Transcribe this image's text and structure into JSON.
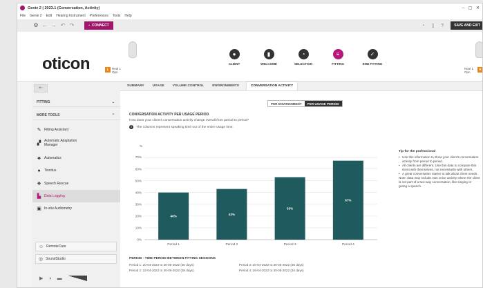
{
  "window": {
    "title": "Genie 2 | 2023.1 (Conversation, Activity)",
    "controls": "– ▢ ✕"
  },
  "menu": [
    "File",
    "Genie 2",
    "Edit",
    "Hearing Instrument",
    "Preferences",
    "Tools",
    "Help"
  ],
  "toolbar": {
    "connect_label": "CONNECT",
    "save_exit_label": "SAVE AND EXIT"
  },
  "header": {
    "logo": "oticon",
    "left_device": {
      "badge": "L",
      "line1": "Real 1",
      "line2": "Opn"
    },
    "right_device": {
      "badge": "R",
      "line1": "Real 1",
      "line2": "Opn"
    },
    "steps": [
      {
        "label": "CLIENT",
        "icon": "person-icon",
        "glyph": "●"
      },
      {
        "label": "WELCOME",
        "icon": "hearing-aid-icon",
        "glyph": "▮"
      },
      {
        "label": "SELECTION",
        "icon": "gauge-icon",
        "glyph": "◔"
      },
      {
        "label": "FITTING",
        "icon": "sliders-icon",
        "glyph": "≡"
      },
      {
        "label": "END FITTING",
        "icon": "check-icon",
        "glyph": "✓"
      }
    ],
    "active_step": "FITTING"
  },
  "sidebar": {
    "section_fitting": "FITTING",
    "section_more_tools": "MORE TOOLS",
    "items": [
      {
        "label": "Fitting Assistant",
        "icon": "wand-icon",
        "glyph": "✎"
      },
      {
        "label": "Automatic Adaptation Manager",
        "icon": "chart-icon",
        "glyph": "▞"
      },
      {
        "label": "Automatics",
        "icon": "automatics-icon",
        "glyph": "♣"
      },
      {
        "label": "Tinnitus",
        "icon": "tinnitus-icon",
        "glyph": "●"
      },
      {
        "label": "Speech Rescue",
        "icon": "speech-icon",
        "glyph": "❖"
      },
      {
        "label": "Data Logging",
        "icon": "data-logging-icon",
        "glyph": "▙"
      },
      {
        "label": "In-situ Audiometry",
        "icon": "audiometry-icon",
        "glyph": "▣"
      }
    ],
    "active_item": "Data Logging",
    "remote_care": "RemoteCare",
    "sound_studio": "SoundStudio"
  },
  "tabs": [
    "SUMMARY",
    "USAGE",
    "VOLUME CONTROL",
    "ENVIRONMENTS",
    "CONVERSATION ACTIVITY"
  ],
  "active_tab": "CONVERSATION ACTIVITY",
  "toggle": {
    "option1": "PER ENVIRONMENT",
    "option2": "PER USAGE PERIOD",
    "selected": "PER USAGE PERIOD"
  },
  "section": {
    "title": "CONVERSATION ACTIVITY PER USAGE PERIOD",
    "question": "How does your client's conversation activity change overall from period to period?",
    "info": "The columns represent speaking time out of the entire usage time."
  },
  "chart_data": {
    "type": "bar",
    "categories": [
      "Period 1",
      "Period 2",
      "Period 3",
      "Period 4"
    ],
    "values": [
      40,
      43,
      53,
      67
    ],
    "data_labels": [
      "40%",
      "43%",
      "53%",
      "67%"
    ],
    "ylabel": "%",
    "yticks": [
      "0%",
      "10%",
      "20%",
      "30%",
      "40%",
      "50%",
      "60%",
      "70%"
    ],
    "ylim": [
      0,
      75
    ],
    "bar_color": "#1f5a5e",
    "grid": true
  },
  "tip": {
    "title": "Tip for the professional",
    "bullets": [
      "Use this information to show your client's conversation activity from period to period.",
      "All clients are different. Use this data to compare this client with themselves, not necessarily with others.",
      "A great conversation starter to talk about client needs."
    ],
    "note": "Note: data may include own voice activity where the client is not part of a two-way conversation, like singing or giving a speech."
  },
  "periods": {
    "title": "PERIOD - TIME PERIOD BETWEEN FITTING SESSIONS",
    "p1": "Period 1: 20-04-2022 to 30-05-2022 (40 days)",
    "p2": "Period 2: 22-04-2022 to 30-05-2022 (38 days)",
    "p3": "Period 3: 20-04-2022 to 30-05-2022 (36 days)",
    "p4": "Period 4: 26-04-2022 to 30-05-2022 (34 days)"
  },
  "colors": {
    "accent": "#b5177a",
    "bar": "#1f5a5e",
    "badge": "#e8851f"
  }
}
